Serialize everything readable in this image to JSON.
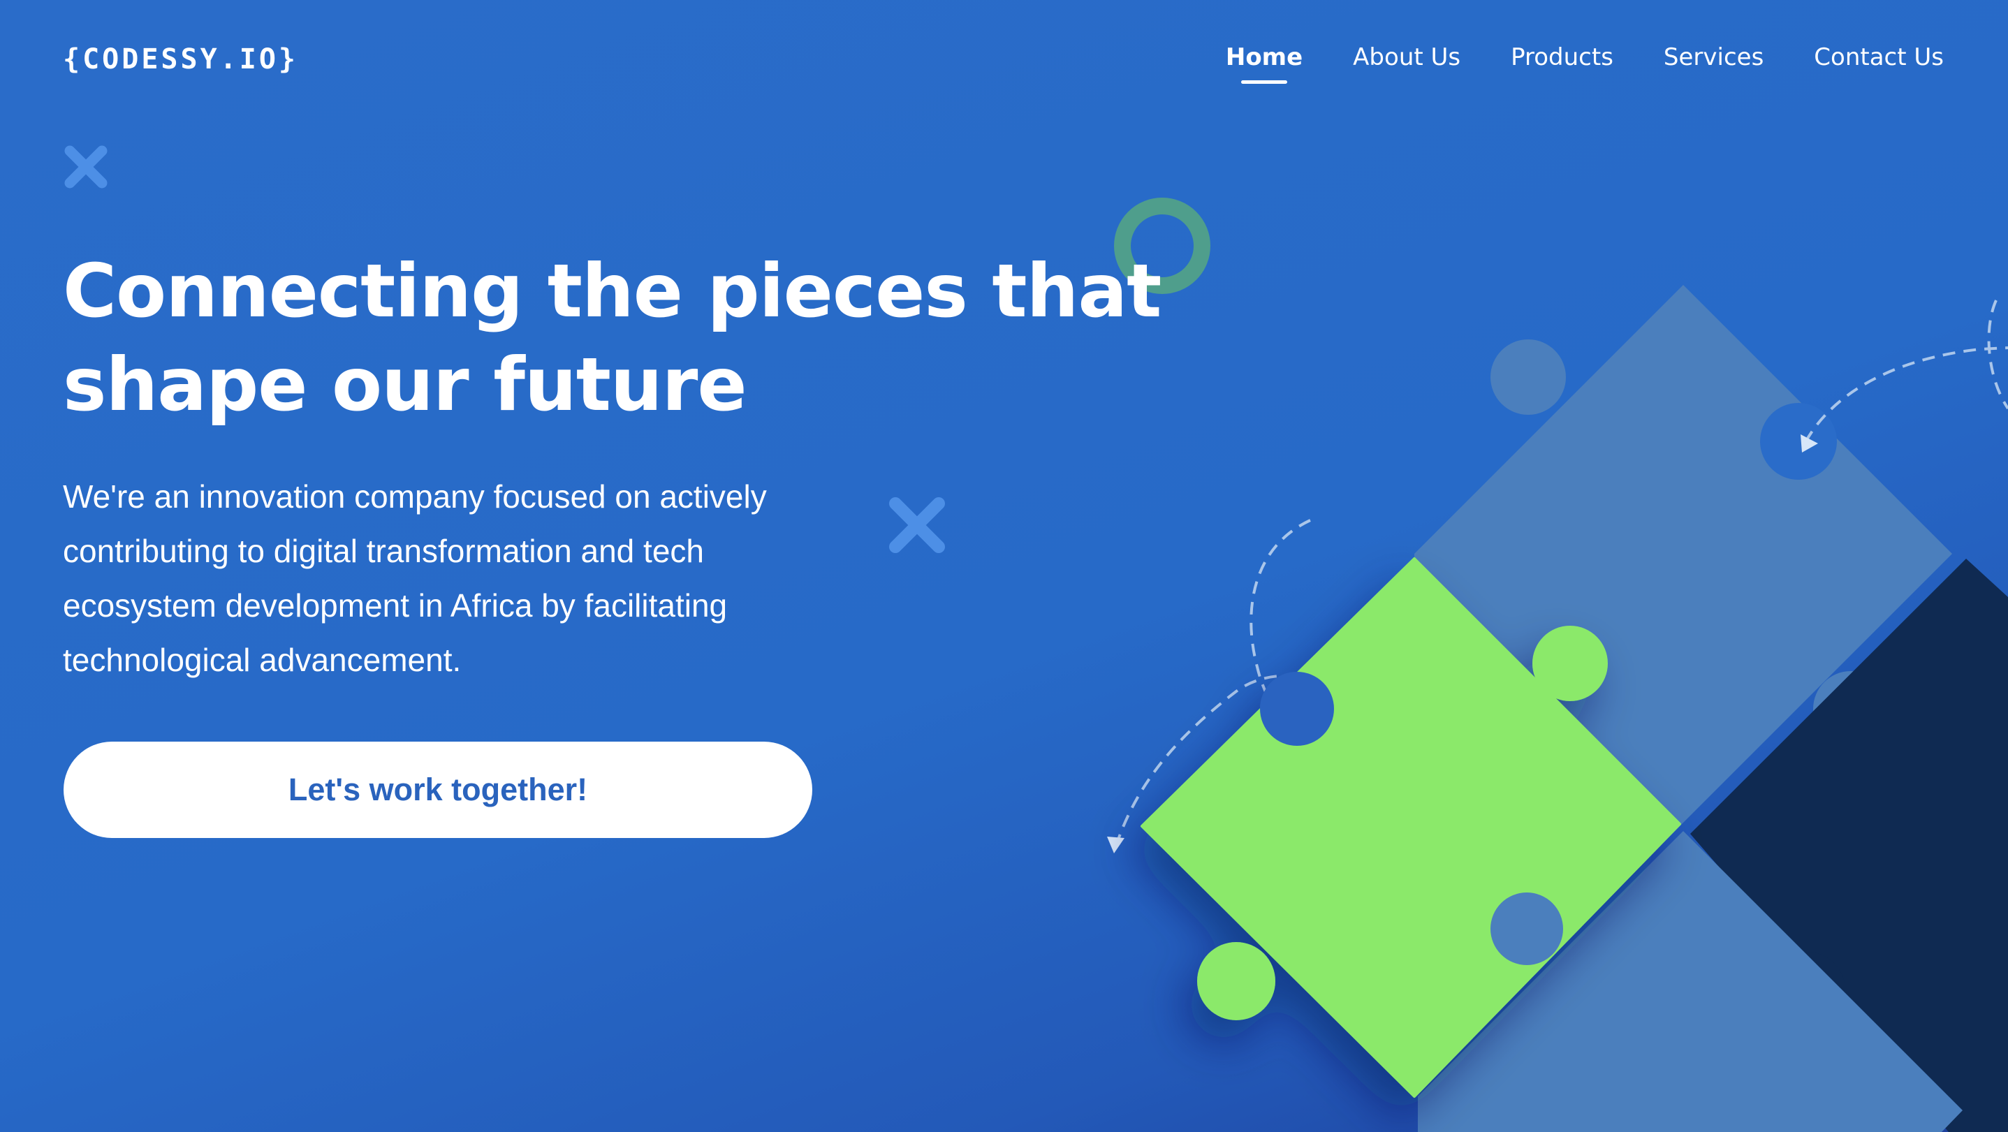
{
  "brand": {
    "logo_text": "{CODESSY.IO}"
  },
  "nav": {
    "items": [
      {
        "label": "Home",
        "active": true
      },
      {
        "label": "About Us",
        "active": false
      },
      {
        "label": "Products",
        "active": false
      },
      {
        "label": "Services",
        "active": false
      },
      {
        "label": "Contact Us",
        "active": false
      }
    ]
  },
  "hero": {
    "title": "Connecting the pieces that shape our future",
    "description": "We're an innovation company focused on actively contributing to digital transformation and tech ecosystem development in Africa by facilitating technological advancement.",
    "cta_label": "Let's work together!"
  },
  "decorations": {
    "icons": [
      "close-x-icon",
      "close-x-icon",
      "ring-icon",
      "puzzle-pieces-illustration",
      "dashed-arrow-icon",
      "dashed-arrow-icon"
    ]
  },
  "colors": {
    "background": "#2a6cc9",
    "button_text": "#2a63bd",
    "puzzle_green": "#8be96a",
    "puzzle_steel": "#4b7fbd",
    "puzzle_navy": "#0f2a52",
    "ring": "#4f9e8c",
    "x_mark": "#4d8fe6"
  }
}
